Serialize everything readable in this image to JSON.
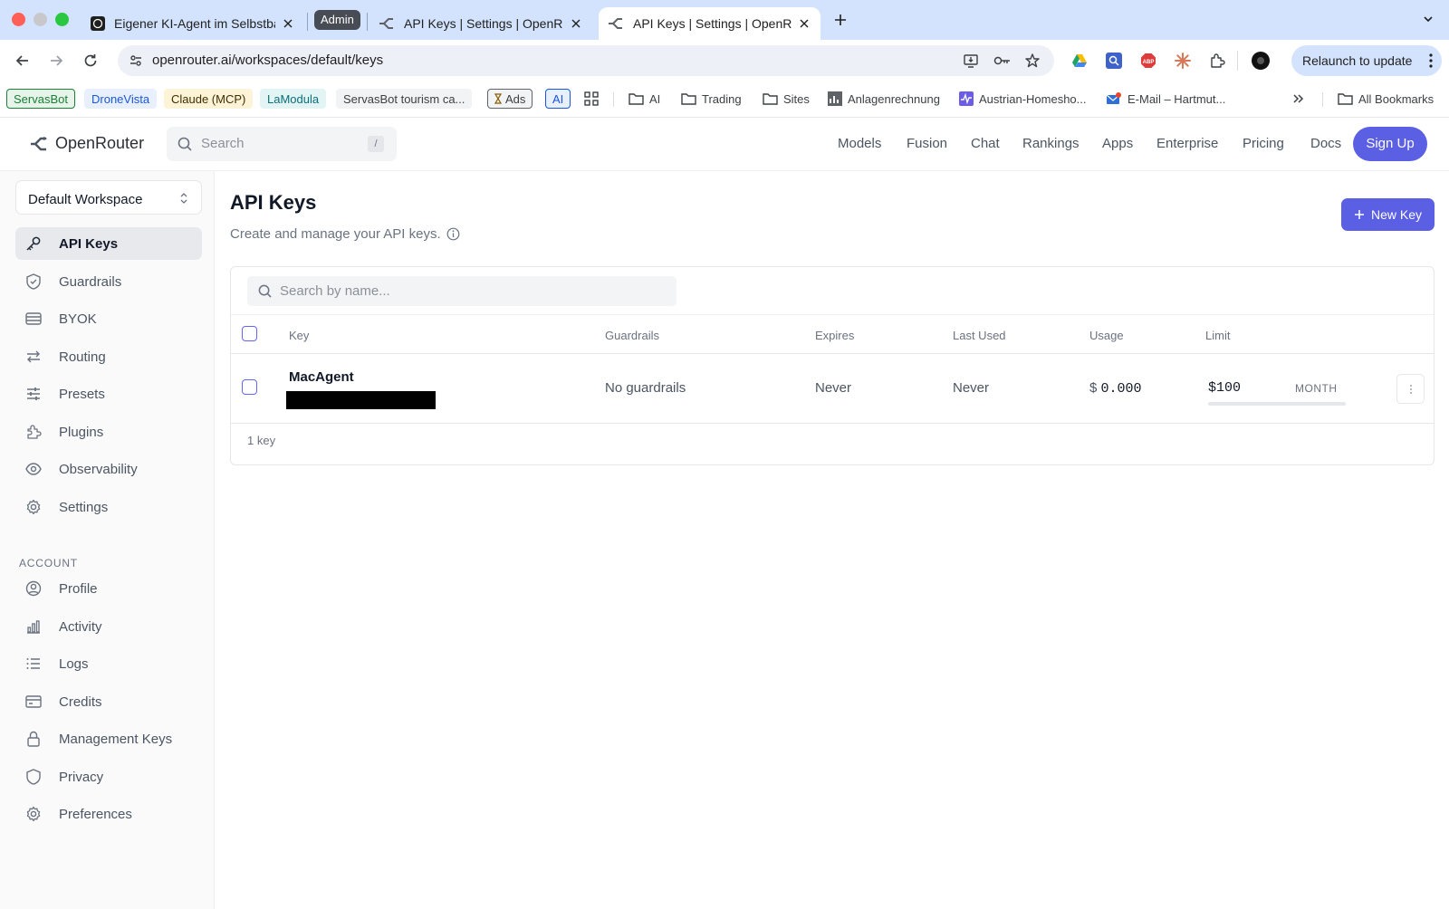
{
  "browser": {
    "tabs": [
      {
        "title": "Eigener KI-Agent im Selbstba",
        "active": false
      },
      {
        "title": "API Keys | Settings | OpenRou",
        "active": false
      },
      {
        "title": "API Keys | Settings | OpenRou",
        "active": true
      }
    ],
    "admin_label": "Admin",
    "url": "openrouter.ai/workspaces/default/keys",
    "relaunch_label": "Relaunch to update",
    "bookmarks": [
      {
        "label": "ServasBot",
        "color": "#1a7f37",
        "bg": "#e6f4ea",
        "border": "#1a7f37"
      },
      {
        "label": "DroneVista",
        "color": "#1a56db",
        "bg": "#e8f0fe",
        "border": "#e8f0fe"
      },
      {
        "label": "Claude (MCP)",
        "color": "#3c2f00",
        "bg": "#fdf3d6",
        "border": "#fdf3d6"
      },
      {
        "label": "LaModula",
        "color": "#0b6e79",
        "bg": "#e3f4f5",
        "border": "#e3f4f5"
      },
      {
        "label": "ServasBot tourism ca...",
        "color": "#3c4043",
        "bg": "#f1f3f4",
        "border": "#f1f3f4"
      },
      {
        "label": "Ads",
        "color": "#3c4043",
        "bg": "#f1f3f4",
        "border": "#5f6368"
      },
      {
        "label": "AI",
        "color": "#1a56db",
        "bg": "#e8f0fe",
        "border": "#1a56db"
      }
    ],
    "folders": [
      "AI",
      "Trading",
      "Sites"
    ],
    "bookmark_links": [
      "Anlagenrechnung",
      "Austrian-Homesho...",
      "E-Mail – Hartmut..."
    ],
    "all_bookmarks": "All Bookmarks"
  },
  "app": {
    "brand": "OpenRouter",
    "search_placeholder": "Search",
    "search_shortcut": "/",
    "nav": [
      "Models",
      "Fusion",
      "Chat",
      "Rankings",
      "Apps",
      "Enterprise",
      "Pricing",
      "Docs"
    ],
    "signup_label": "Sign Up",
    "accent": "#5b5fe3"
  },
  "sidebar": {
    "workspace": "Default Workspace",
    "items": [
      {
        "label": "API Keys",
        "icon": "key-icon",
        "active": true
      },
      {
        "label": "Guardrails",
        "icon": "shield-icon"
      },
      {
        "label": "BYOK",
        "icon": "database-icon"
      },
      {
        "label": "Routing",
        "icon": "arrows-icon"
      },
      {
        "label": "Presets",
        "icon": "sliders-icon"
      },
      {
        "label": "Plugins",
        "icon": "puzzle-icon"
      },
      {
        "label": "Observability",
        "icon": "eye-icon"
      },
      {
        "label": "Settings",
        "icon": "gear-icon"
      }
    ],
    "account_heading": "ACCOUNT",
    "account_items": [
      {
        "label": "Profile",
        "icon": "user-circle-icon"
      },
      {
        "label": "Activity",
        "icon": "bar-chart-icon"
      },
      {
        "label": "Logs",
        "icon": "list-icon"
      },
      {
        "label": "Credits",
        "icon": "credit-card-icon"
      },
      {
        "label": "Management Keys",
        "icon": "lock-icon"
      },
      {
        "label": "Privacy",
        "icon": "shield-icon"
      },
      {
        "label": "Preferences",
        "icon": "gear-icon"
      }
    ]
  },
  "main": {
    "title": "API Keys",
    "subtitle": "Create and manage your API keys.",
    "new_key_label": "New Key",
    "search_placeholder": "Search by name...",
    "columns": [
      "Key",
      "Guardrails",
      "Expires",
      "Last Used",
      "Usage",
      "Limit"
    ],
    "rows": [
      {
        "name": "MacAgent",
        "guardrails": "No guardrails",
        "expires": "Never",
        "last_used": "Never",
        "usage_currency": "$",
        "usage_value": "0.000",
        "limit": "$100",
        "limit_period": "MONTH",
        "limit_used_fraction": 0
      }
    ],
    "count_label": "1 key"
  }
}
